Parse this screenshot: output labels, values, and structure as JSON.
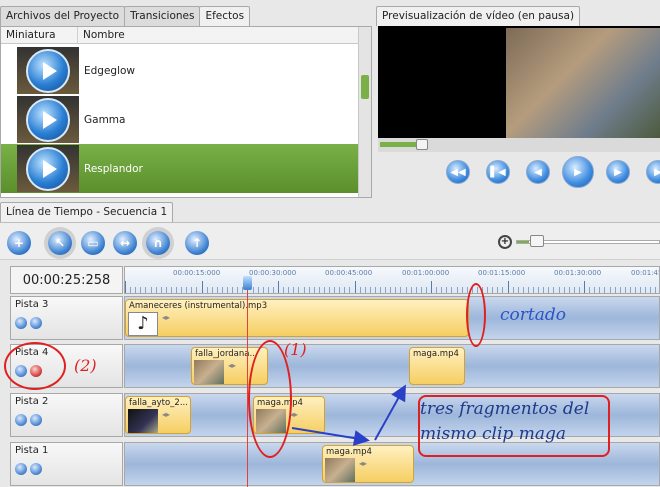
{
  "tabs": {
    "project_files": "Archivos del Proyecto",
    "transitions": "Transiciones",
    "effects": "Efectos"
  },
  "effects_panel": {
    "col_thumbnail": "Miniatura",
    "col_name": "Nombre",
    "items": [
      {
        "name": "Edgeglow"
      },
      {
        "name": "Gamma"
      },
      {
        "name": "Resplandor",
        "selected": true
      }
    ],
    "accent_color": "#6fa23b"
  },
  "preview": {
    "tab_label": "Previsualización de vídeo (en pausa)",
    "progress_fraction": 0.13
  },
  "timeline": {
    "tab_label": "Línea de Tiempo - Secuencia 1",
    "current_time": "00:00:25:258",
    "ruler_labels": [
      "00:00:15:000",
      "00:00:30:000",
      "00:00:45:000",
      "00:01:00:000",
      "00:01:15:000",
      "00:01:30:000",
      "00:01:45"
    ],
    "zoom_fraction": 0.08,
    "tracks": [
      {
        "name": "Pista 3",
        "clips": [
          {
            "title": "Amaneceres (instrumental).mp3"
          }
        ]
      },
      {
        "name": "Pista 4",
        "clips": [
          {
            "title": "falla_jordana..."
          },
          {
            "title": "maga.mp4"
          }
        ]
      },
      {
        "name": "Pista 2",
        "clips": [
          {
            "title": "falla_aytо_2..."
          },
          {
            "title": "maga.mp4"
          }
        ]
      },
      {
        "name": "Pista 1",
        "clips": [
          {
            "title": "maga.mp4"
          }
        ]
      }
    ]
  },
  "annotations": {
    "cortado": "cortado",
    "label_1": "(1)",
    "label_2": "(2)",
    "note_line1": "tres fragmentos del",
    "note_line2": "mismo clip maga"
  }
}
